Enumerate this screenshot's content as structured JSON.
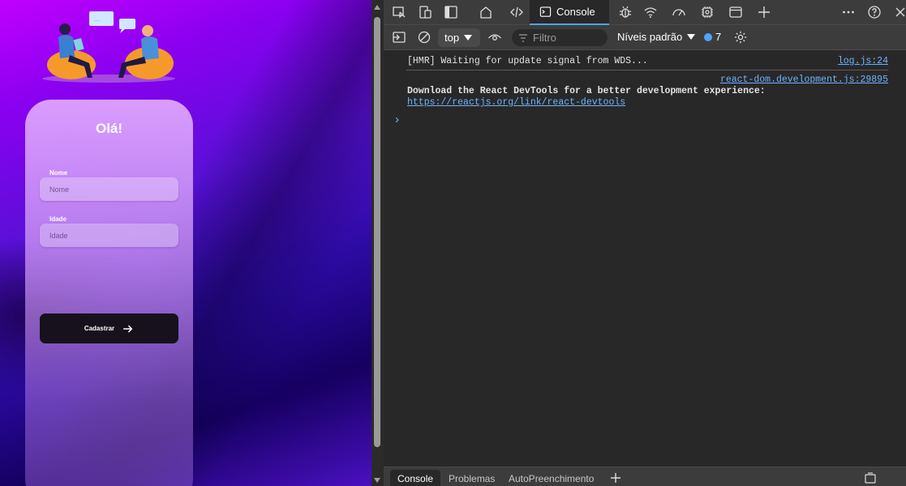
{
  "app": {
    "card_title": "Olá!",
    "name_label": "Nome",
    "name_placeholder": "Nome",
    "age_label": "Idade",
    "age_placeholder": "Idade",
    "submit_label": "Cadastrar",
    "chat_bubble_text": "..."
  },
  "devtools": {
    "tabs": [
      "Console"
    ],
    "toolbar": {
      "context": "top",
      "filter_placeholder": "Filtro",
      "levels": "Níveis padrão",
      "issues_count": "7"
    },
    "messages": [
      {
        "text": "[HMR] Waiting for update signal from WDS...",
        "source": "log.js:24"
      },
      {
        "text": "Download the React DevTools for a better development experience:",
        "link": "https://reactjs.org/link/react-devtools",
        "source": "react-dom.development.js:29895"
      }
    ],
    "drawer_tabs": [
      "Console",
      "Problemas",
      "AutoPreenchimento"
    ]
  },
  "colors": {
    "accent": "#4da3ff",
    "button_dark": "#16111c"
  }
}
